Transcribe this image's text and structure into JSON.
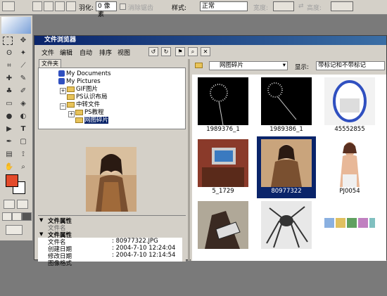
{
  "options_bar": {
    "feather_label": "羽化:",
    "feather_value": "0 像素",
    "antialias_label": "消除锯齿",
    "style_label": "样式:",
    "style_value": "正常",
    "width_label": "宽度:",
    "height_label": "高度:"
  },
  "file_browser": {
    "title": "文件浏览器",
    "menu": [
      "文件",
      "编辑",
      "自动",
      "排序",
      "视图"
    ],
    "folders_tab": "文件夹",
    "tree": [
      {
        "label": "My Documents",
        "level": 1
      },
      {
        "label": "My Pictures",
        "level": 1
      },
      {
        "label": "GIF图片",
        "level": 2
      },
      {
        "label": "PS认识布局",
        "level": 2
      },
      {
        "label": "中转文件",
        "level": 2
      },
      {
        "label": "PS教程",
        "level": 3
      },
      {
        "label": "网图碎片",
        "level": 3,
        "selected": true
      }
    ],
    "path_value": "网图碎片",
    "show_label": "显示:",
    "show_value": "带标记和不带标记",
    "metadata": {
      "section1": "文件属性",
      "section1_sub": "文件名",
      "section2": "文件属性",
      "rows": [
        {
          "label": "文件名",
          "value": ": 80977322.JPG"
        },
        {
          "label": "创建日期",
          "value": ": 2004-7-10 12:24:04"
        },
        {
          "label": "修改日期",
          "value": ": 2004-7-10 12:14:54"
        },
        {
          "label": "图像格式",
          "value": ""
        }
      ]
    },
    "thumbnails": [
      {
        "caption": "1989376_1"
      },
      {
        "caption": "1989386_1"
      },
      {
        "caption": "45552855"
      },
      {
        "caption": "5_1729"
      },
      {
        "caption": "80977322",
        "selected": true
      },
      {
        "caption": "PJ0054"
      },
      {
        "caption": ""
      },
      {
        "caption": ""
      },
      {
        "caption": ""
      }
    ]
  },
  "colors": {
    "foreground": "#e34a2a",
    "background": "#ffffff",
    "titlebar": "#0a246a"
  },
  "icons": [
    "marquee-icon",
    "lasso-icon",
    "crop-icon",
    "brush-icon",
    "type-icon",
    "zoom-icon",
    "folder-icon",
    "rotate-icon",
    "search-icon"
  ]
}
